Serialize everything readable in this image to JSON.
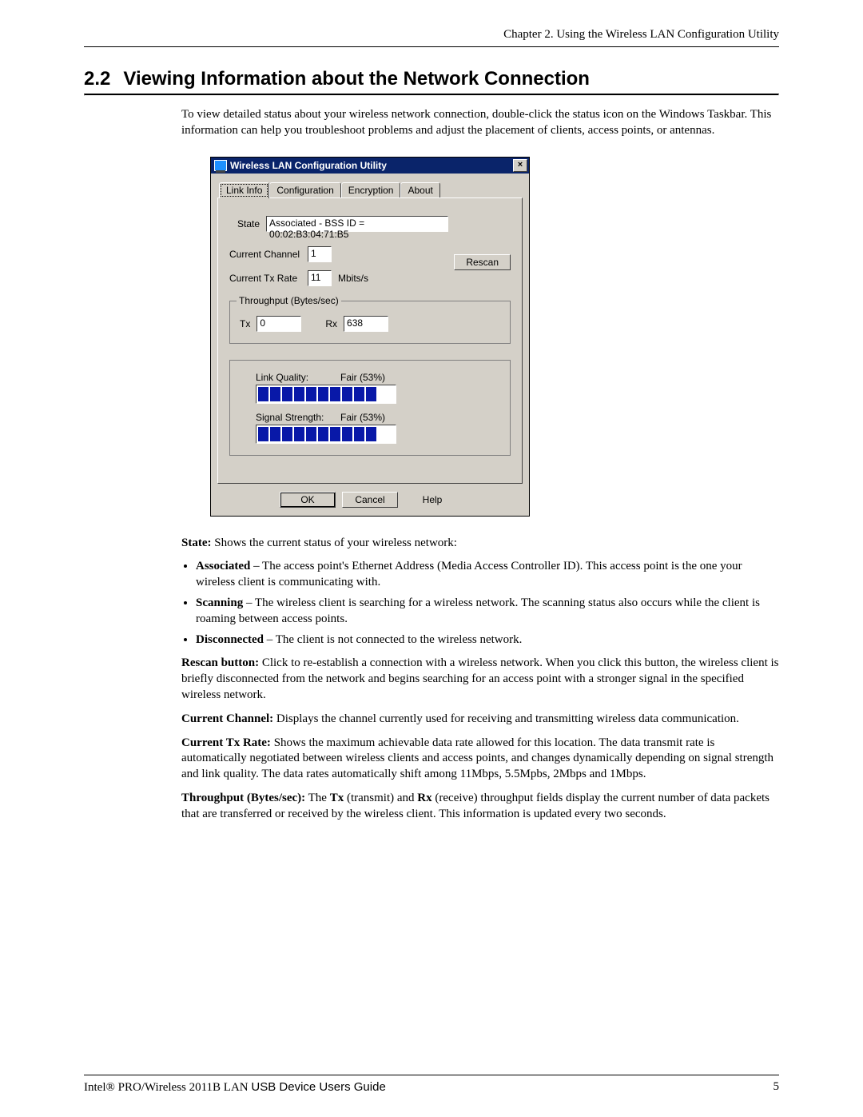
{
  "header": {
    "chapter_line": "Chapter 2. Using the Wireless LAN Configuration Utility"
  },
  "section": {
    "number": "2.2",
    "title": "Viewing Information about the Network Connection"
  },
  "intro": "To view detailed status about your wireless network connection, double-click the status icon on the Windows Taskbar. This information can help you troubleshoot problems and adjust the placement of clients, access points, or antennas.",
  "dialog": {
    "title": "Wireless LAN Configuration Utility",
    "close_glyph": "×",
    "tabs": [
      "Link Info",
      "Configuration",
      "Encryption",
      "About"
    ],
    "active_tab_index": 0,
    "state_label": "State",
    "state_value": "Associated - BSS ID = 00:02:B3:04:71:B5",
    "channel_label": "Current Channel",
    "channel_value": "1",
    "txrate_label": "Current Tx Rate",
    "txrate_value": "11",
    "txrate_unit": "Mbits/s",
    "rescan_label": "Rescan",
    "throughput_legend": "Throughput (Bytes/sec)",
    "tx_label": "Tx",
    "tx_value": "0",
    "rx_label": "Rx",
    "rx_value": "638",
    "link_quality_label": "Link Quality:",
    "link_quality_value": "Fair (53%)",
    "signal_label": "Signal Strength:",
    "signal_value": "Fair (53%)",
    "meter_filled": 10,
    "ok_label": "OK",
    "cancel_label": "Cancel",
    "help_label": "Help"
  },
  "descriptions": {
    "state_head": "State:",
    "state_text": " Shows the current status of your wireless network:",
    "bullets": [
      {
        "term": "Associated",
        "text": " – The access point's Ethernet Address (Media Access Controller ID). This access point is the one your wireless client is communicating with."
      },
      {
        "term": "Scanning",
        "text": " – The wireless client is searching for a wireless network. The scanning status also occurs while the client is roaming between access points."
      },
      {
        "term": "Disconnected",
        "text": " – The client is not connected to the wireless network."
      }
    ],
    "rescan_head": "Rescan button:",
    "rescan_text": "  Click to re-establish a connection with a wireless network. When you click this button, the wireless client is briefly disconnected from the network and begins searching for an access point with a stronger signal in the specified wireless network.",
    "channel_head": "Current Channel:",
    "channel_text": " Displays the channel currently used for receiving and transmitting wireless data communication.",
    "txrate_head": "Current Tx Rate:",
    "txrate_text": " Shows the maximum achievable data rate allowed for this location. The data transmit rate is automatically negotiated between wireless clients and access points, and changes dynamically depending on signal strength and link quality. The data rates automatically shift among 11Mbps, 5.5Mpbs, 2Mbps and 1Mbps.",
    "throughput_head": "Throughput (Bytes/sec):",
    "throughput_mid1": " The ",
    "throughput_tx": "Tx",
    "throughput_mid2": " (transmit) and ",
    "throughput_rx": "Rx",
    "throughput_text": " (receive) throughput fields display the current number of data packets that are transferred or received by the wireless client. This information is updated every two seconds."
  },
  "footer": {
    "left_serif": "Intel® PRO/Wireless 2011B LAN ",
    "left_sans": "USB Device Users Guide",
    "page": "5"
  }
}
